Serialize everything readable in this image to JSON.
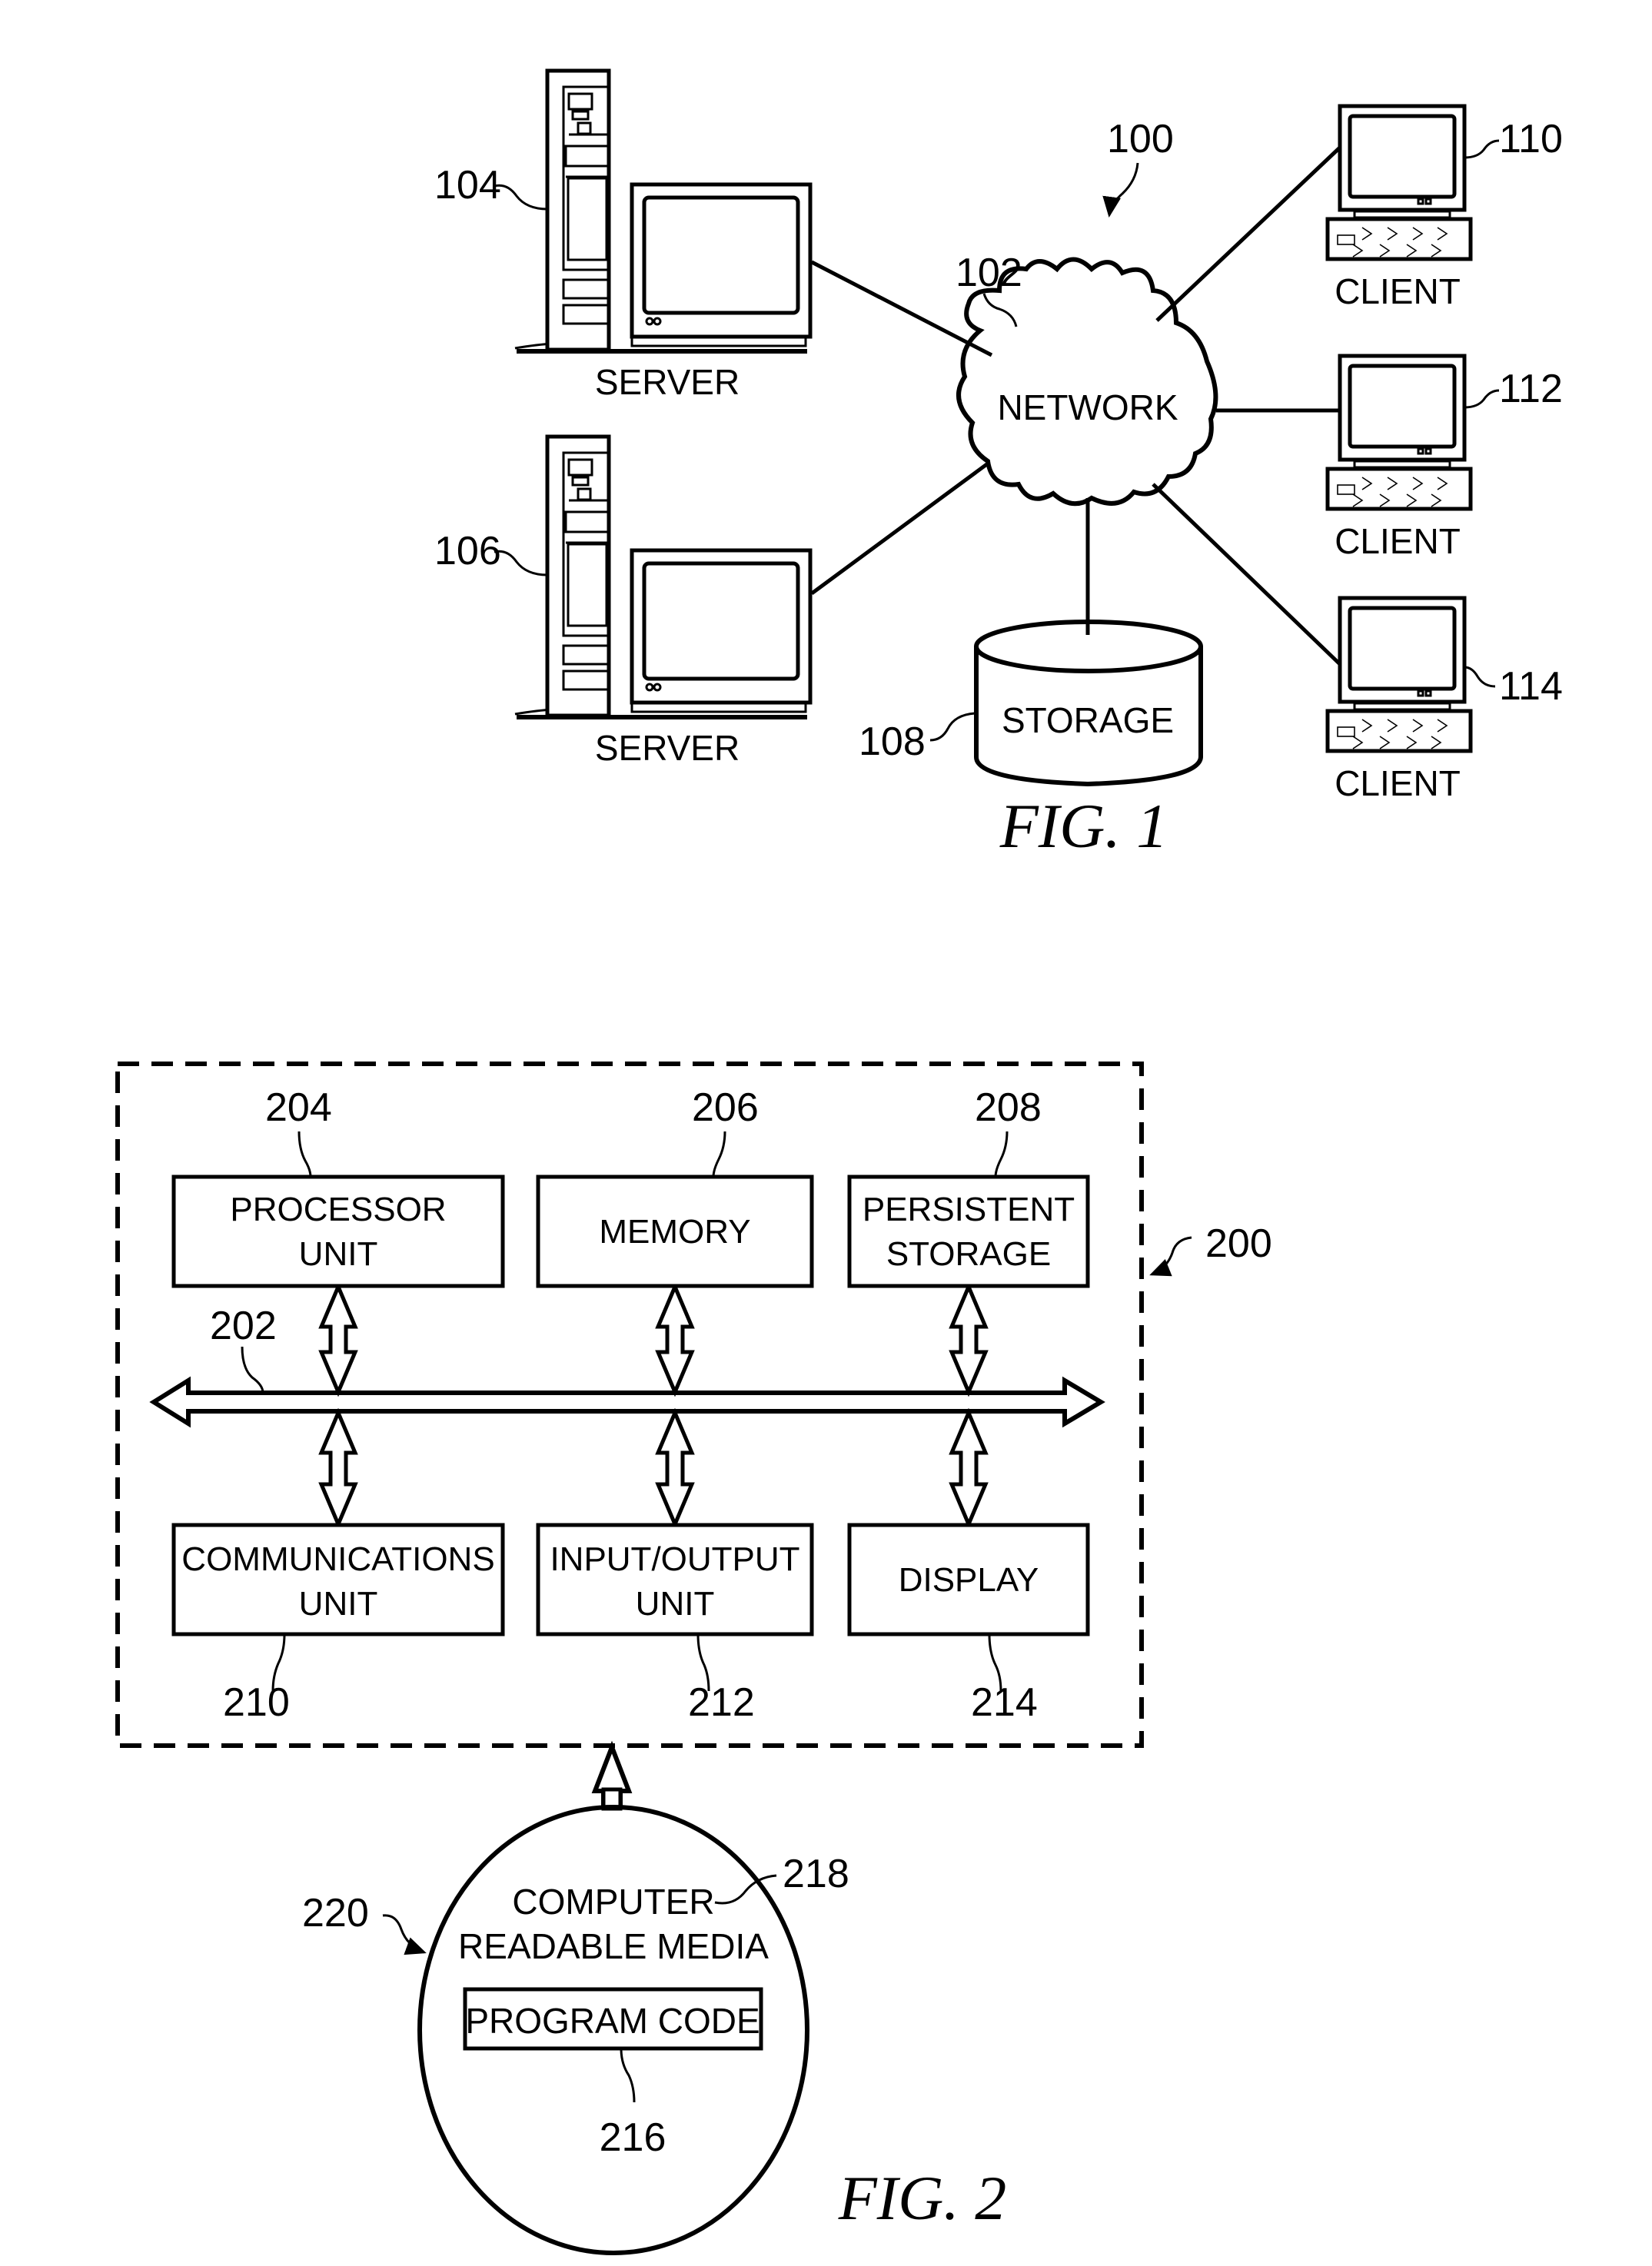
{
  "figure1": {
    "caption": "FIG. 1",
    "system_ref": "100",
    "network": {
      "label": "NETWORK",
      "ref": "102"
    },
    "servers": [
      {
        "label": "SERVER",
        "ref": "104"
      },
      {
        "label": "SERVER",
        "ref": "106"
      }
    ],
    "storage": {
      "label": "STORAGE",
      "ref": "108"
    },
    "clients": [
      {
        "label": "CLIENT",
        "ref": "110"
      },
      {
        "label": "CLIENT",
        "ref": "112"
      },
      {
        "label": "CLIENT",
        "ref": "114"
      }
    ]
  },
  "figure2": {
    "caption": "FIG. 2",
    "system_ref": "200",
    "bus_ref": "202",
    "top_blocks": [
      {
        "line1": "PROCESSOR",
        "line2": "UNIT",
        "ref": "204"
      },
      {
        "line1": "MEMORY",
        "line2": "",
        "ref": "206"
      },
      {
        "line1": "PERSISTENT",
        "line2": "STORAGE",
        "ref": "208"
      }
    ],
    "bottom_blocks": [
      {
        "line1": "COMMUNICATIONS",
        "line2": "UNIT",
        "ref": "210"
      },
      {
        "line1": "INPUT/OUTPUT",
        "line2": "UNIT",
        "ref": "212"
      },
      {
        "line1": "DISPLAY",
        "line2": "",
        "ref": "214"
      }
    ],
    "media": {
      "line1": "COMPUTER",
      "line2": "READABLE MEDIA",
      "media_ref": "218",
      "product_ref": "220",
      "program_code": {
        "label": "PROGRAM CODE",
        "ref": "216"
      }
    }
  }
}
